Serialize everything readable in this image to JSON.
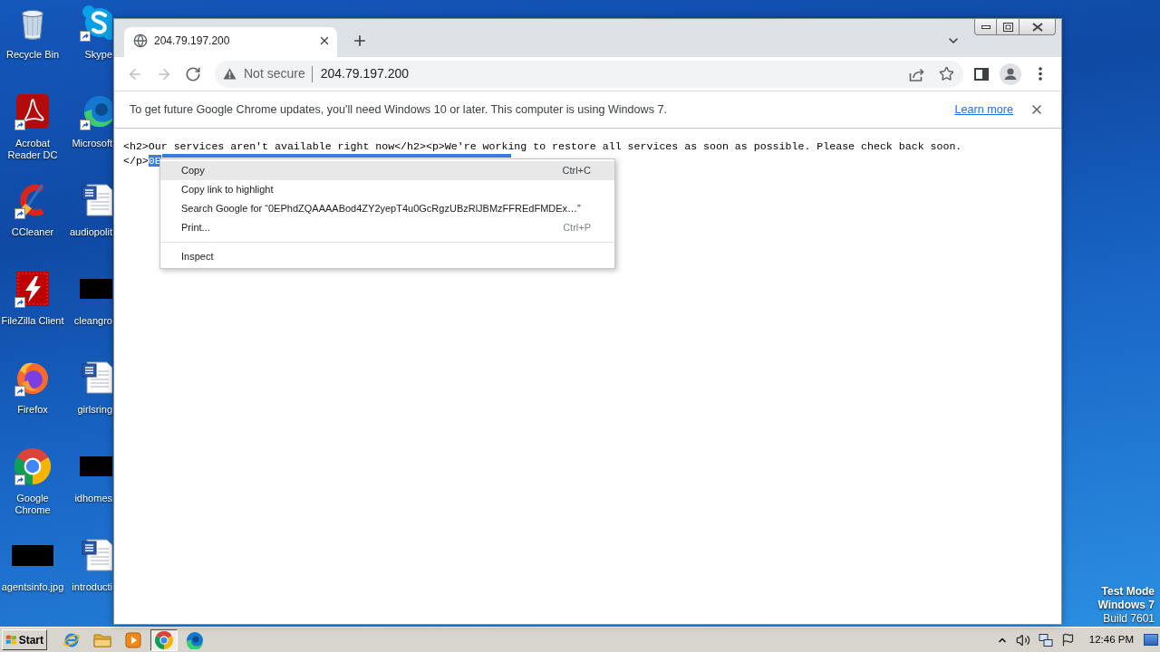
{
  "desktop": {
    "columns": [
      {
        "icons": [
          {
            "label": "Recycle Bin",
            "kind": "recycle-bin",
            "shortcut": false
          },
          {
            "label": "Acrobat Reader DC",
            "kind": "acrobat",
            "shortcut": true
          },
          {
            "label": "CCleaner",
            "kind": "ccleaner",
            "shortcut": true
          },
          {
            "label": "FileZilla Client",
            "kind": "filezilla",
            "shortcut": true
          },
          {
            "label": "Firefox",
            "kind": "firefox",
            "shortcut": true
          },
          {
            "label": "Google Chrome",
            "kind": "chrome",
            "shortcut": true
          },
          {
            "label": "agentsinfo.jpg",
            "kind": "redacted",
            "shortcut": false
          }
        ]
      },
      {
        "icons": [
          {
            "label": "Skype",
            "kind": "skype",
            "shortcut": true
          },
          {
            "label": "Microsoft",
            "kind": "edge",
            "shortcut": true
          },
          {
            "label": "audiopolit",
            "kind": "word",
            "shortcut": false
          },
          {
            "label": "cleangro",
            "kind": "redacted",
            "shortcut": false
          },
          {
            "label": "girlsring",
            "kind": "word",
            "shortcut": false
          },
          {
            "label": "idhomes",
            "kind": "redacted",
            "shortcut": false
          },
          {
            "label": "introducti",
            "kind": "word",
            "shortcut": false
          }
        ]
      }
    ]
  },
  "browser": {
    "tabs": [
      {
        "title": "204.79.197.200",
        "selected": true
      }
    ],
    "nav_buttons": [
      {
        "kind": "back",
        "disabled": true
      },
      {
        "kind": "forward",
        "disabled": true
      },
      {
        "kind": "reload",
        "disabled": false
      }
    ],
    "address_bar": {
      "security_label": "Not secure",
      "url": "204.79.197.200"
    },
    "infobar": {
      "message": "To get future Google Chrome updates, you'll need Windows 10 or later. This computer is using Windows 7.",
      "link": "Learn more"
    },
    "page_lines": [
      {
        "segments": [
          {
            "text": "<h2>Our services aren't available right now</h2><p>We're working to restore all services as soon as possible. Please check back soon.",
            "selected": false
          }
        ]
      },
      {
        "segments": [
          {
            "text": "</p>",
            "selected": false
          },
          {
            "text": "0E",
            "selected": true
          }
        ]
      }
    ],
    "context_menu": {
      "items": [
        {
          "kind": "item",
          "label": "Copy",
          "shortcut": "Ctrl+C",
          "selected": true
        },
        {
          "kind": "item",
          "label": "Copy link to highlight",
          "selected": false
        },
        {
          "kind": "item",
          "label": "Search Google for “0EPhdZQAAAABod4ZY2yepT4u0GcRgzUBzRlJBMzFFREdFMDEx…”",
          "selected": false
        },
        {
          "kind": "item",
          "label": "Print...",
          "shortcut": "Ctrl+P",
          "selected": false
        },
        {
          "kind": "separator"
        },
        {
          "kind": "item",
          "label": "Inspect",
          "selected": false
        }
      ]
    }
  },
  "desktop_notice": [
    {
      "text": "Test Mode",
      "bold": true
    },
    {
      "text": "Windows 7",
      "bold": true
    },
    {
      "text": "Build 7601",
      "bold": false
    }
  ],
  "taskbar": {
    "start_label": "Start",
    "apps": [
      {
        "kind": "ie",
        "selected": false
      },
      {
        "kind": "explorer",
        "selected": false
      },
      {
        "kind": "media-player",
        "selected": false
      },
      {
        "kind": "chrome",
        "selected": true
      },
      {
        "kind": "edge",
        "selected": false
      }
    ],
    "clock": "12:46 PM"
  }
}
